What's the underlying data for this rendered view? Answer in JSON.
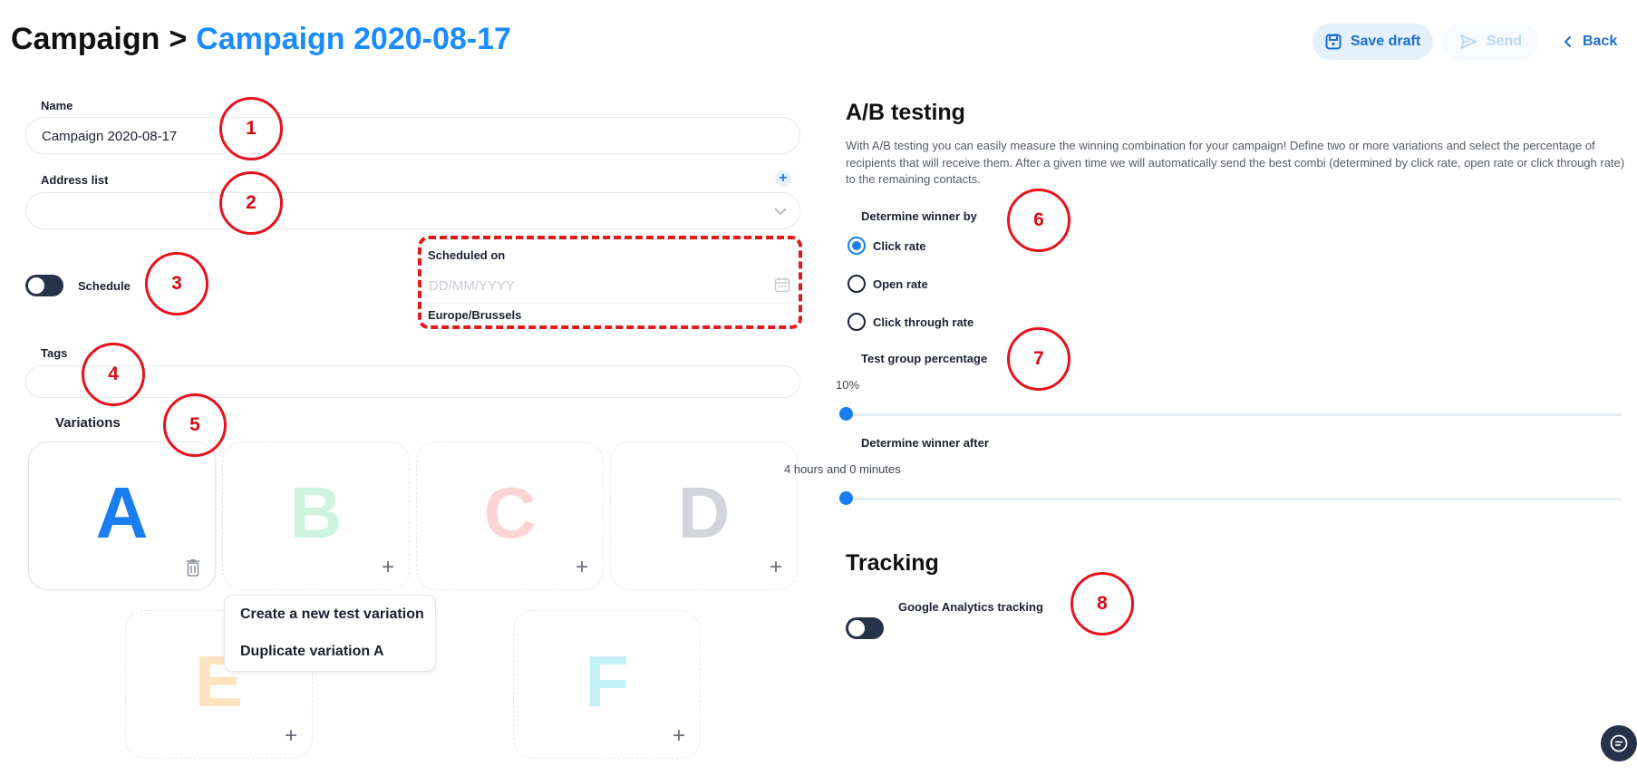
{
  "header": {
    "breadcrumb_root": "Campaign",
    "breadcrumb_separator": ">",
    "current_page": "Campaign 2020-08-17",
    "save_draft_label": "Save draft",
    "send_label": "Send",
    "back_label": "Back"
  },
  "form": {
    "name_label": "Name",
    "name_value": "Campaign 2020-08-17",
    "address_list_label": "Address list",
    "address_list_value": "",
    "schedule_label": "Schedule",
    "schedule_enabled": false,
    "scheduled_on_label": "Scheduled on",
    "scheduled_on_placeholder": "DD/MM/YYYY",
    "timezone": "Europe/Brussels",
    "tags_label": "Tags",
    "tags_value": "",
    "variations_label": "Variations"
  },
  "variations": [
    {
      "letter": "A",
      "color": "#1a7ef0",
      "state": "active"
    },
    {
      "letter": "B",
      "color": "#cdf3e0",
      "state": "empty"
    },
    {
      "letter": "C",
      "color": "#fdd4d4",
      "state": "empty"
    },
    {
      "letter": "D",
      "color": "#d2d6db",
      "state": "empty"
    },
    {
      "letter": "E",
      "color": "#fde4bc",
      "state": "empty"
    },
    {
      "letter": "F",
      "color": "#c2f1f7",
      "state": "empty"
    }
  ],
  "variation_menu": {
    "items": [
      "Create a new test variation",
      "Duplicate variation A"
    ]
  },
  "ab_testing": {
    "title": "A/B testing",
    "description": "With A/B testing you can easily measure the winning combination for your campaign! Define two or more variations and select the percentage of recipients that will receive them. After a given time we will automatically send the best combi (determined by click rate, open rate or click through rate) to the remaining contacts.",
    "winner_by_label": "Determine winner by",
    "options": [
      "Click rate",
      "Open rate",
      "Click through rate"
    ],
    "selected_option": "Click rate",
    "test_group_label": "Test group percentage",
    "test_group_value": "10%",
    "test_group_fraction": 0,
    "winner_after_label": "Determine winner after",
    "winner_after_value": "4 hours and 0 minutes",
    "winner_after_fraction": 0
  },
  "tracking": {
    "title": "Tracking",
    "ga_label": "Google Analytics tracking",
    "ga_enabled": false
  },
  "callouts": [
    "1",
    "2",
    "3",
    "4",
    "5",
    "6",
    "7",
    "8"
  ],
  "colors": {
    "accent": "#1a7ef0",
    "callout_red": "#e8111d",
    "toggle_dark": "#26324a"
  }
}
